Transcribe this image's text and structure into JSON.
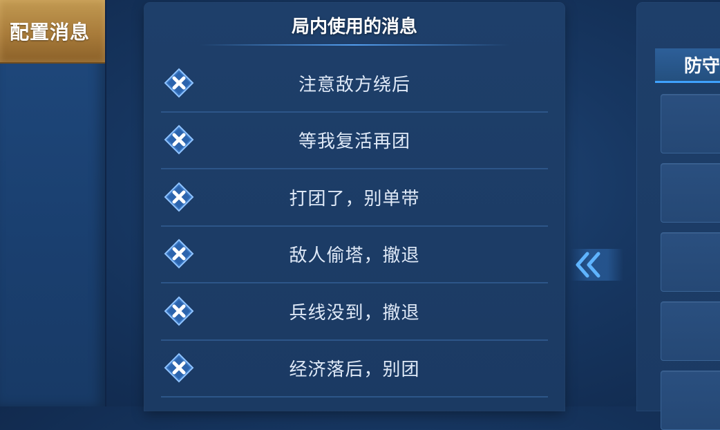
{
  "left_tabs": {
    "config_label": "配置消息"
  },
  "messages_panel": {
    "title": "局内使用的消息",
    "items": [
      {
        "label": "注意敌方绕后"
      },
      {
        "label": "等我复活再团"
      },
      {
        "label": "打团了，别单带"
      },
      {
        "label": "敌人偷塔，撤退"
      },
      {
        "label": "兵线没到，撤退"
      },
      {
        "label": "经济落后，别团"
      }
    ]
  },
  "right_panel": {
    "category_label": "防守"
  },
  "icons": {
    "remove": "close-icon",
    "move": "double-chevron-left-icon"
  },
  "colors": {
    "accent_gold": "#b88a45",
    "accent_blue": "#3fa2ff"
  }
}
